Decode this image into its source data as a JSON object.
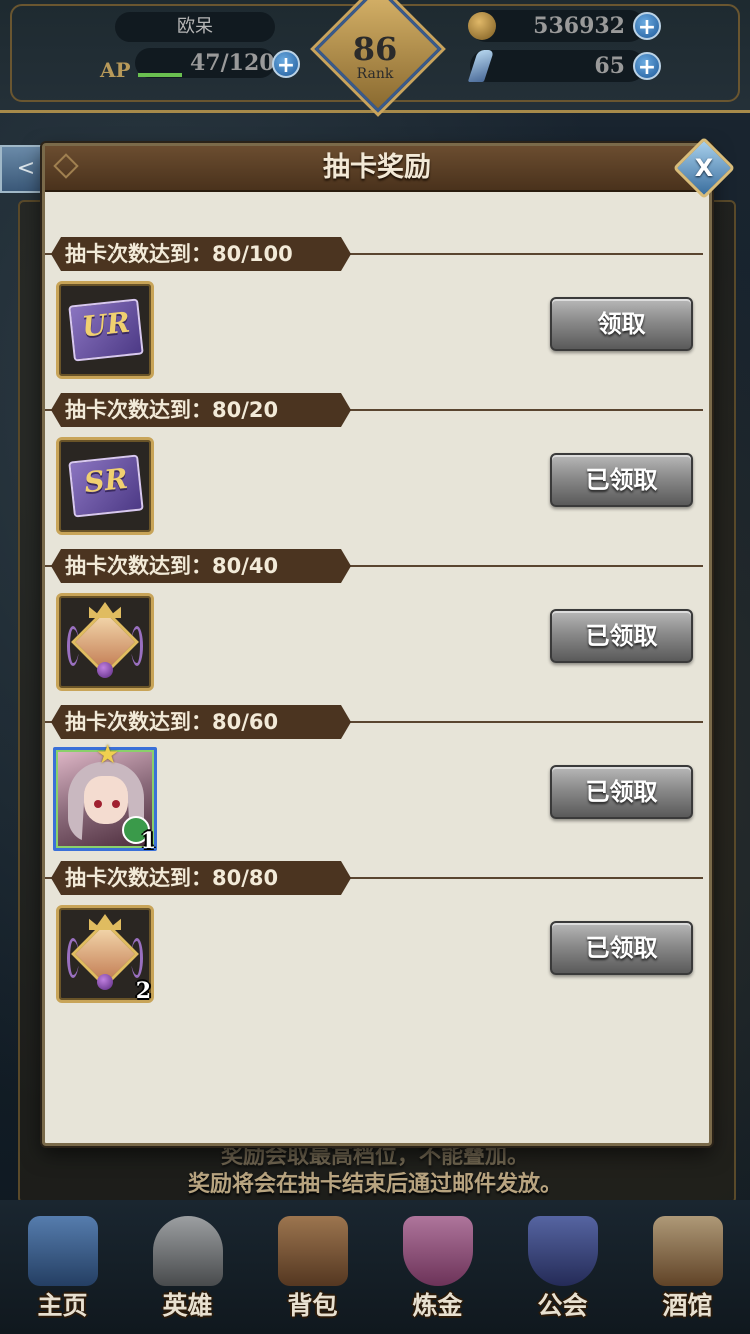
{
  "topbar": {
    "player_name": "欧呆",
    "ap_label": "AP",
    "ap_value": "47/120",
    "ap_fraction": 0.39,
    "rank_number": "86",
    "rank_label": "Rank",
    "gold": "536932",
    "gems": "65",
    "plus_symbol": "+"
  },
  "background": {
    "back_arrow": "<",
    "note_line1": "奖励会取最高档位，不能叠加。",
    "note_line2": "奖励将会在抽卡结束后通过邮件发放。"
  },
  "modal": {
    "title": "抽卡奖励",
    "close_symbol": "X",
    "rows": [
      {
        "label": "抽卡次数达到：80/100",
        "item": "UR card ticket",
        "item_text": "UR",
        "button": "领取",
        "claimed": false
      },
      {
        "label": "抽卡次数达到：80/20",
        "item": "SR card ticket",
        "item_text": "SR",
        "button": "已领取",
        "claimed": true
      },
      {
        "label": "抽卡次数达到：80/40",
        "item": "crowned crystal emblem",
        "button": "已领取",
        "claimed": true
      },
      {
        "label": "抽卡次数达到：80/60",
        "item": "hero portrait",
        "item_level": "1",
        "star": "★",
        "badge_icon": "axe-icon",
        "button": "已领取",
        "claimed": true
      },
      {
        "label": "抽卡次数达到：80/80",
        "item": "crowned crystal emblem",
        "item_count": "2",
        "button": "已领取",
        "claimed": true
      }
    ]
  },
  "bottom_nav": [
    {
      "label": "主页",
      "icon": "castle-icon",
      "color": "#3a6aa8"
    },
    {
      "label": "英雄",
      "icon": "helmet-icon",
      "color": "#8a8a8a"
    },
    {
      "label": "背包",
      "icon": "backpack-icon",
      "color": "#8a5a30"
    },
    {
      "label": "炼金",
      "icon": "potion-icon",
      "color": "#b05a8a"
    },
    {
      "label": "公会",
      "icon": "shield-icon",
      "color": "#3a4a8a"
    },
    {
      "label": "酒馆",
      "icon": "tavern-icon",
      "color": "#8a6a40"
    }
  ],
  "colors": {
    "modal_bg": "#e7e4d8",
    "banner_brown": "#4b3420",
    "frame_gold": "#c8a458",
    "button_gray": "#8a8a8a"
  }
}
